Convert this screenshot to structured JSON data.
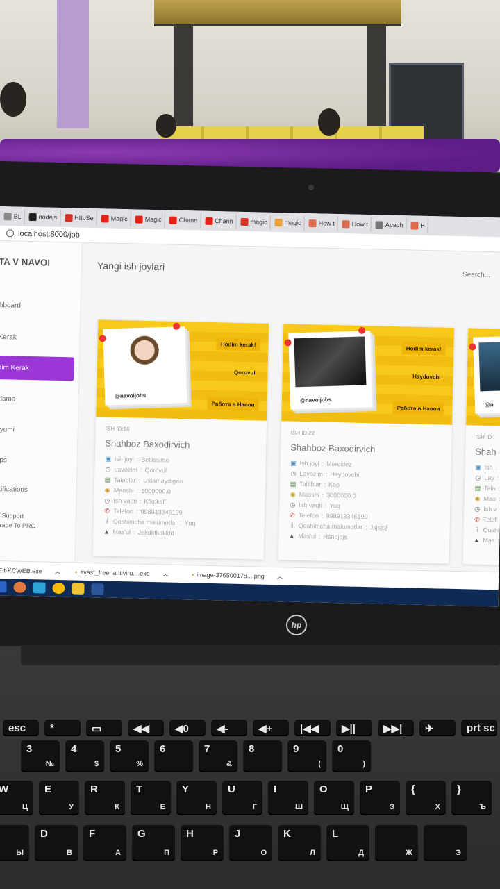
{
  "browser": {
    "tabs": [
      {
        "label": "BL",
        "color": "#888"
      },
      {
        "label": "nodejs",
        "color": "#222"
      },
      {
        "label": "HttpSe",
        "color": "#d93025"
      },
      {
        "label": "Magic",
        "color": "#e62117"
      },
      {
        "label": "Magic",
        "color": "#e62117"
      },
      {
        "label": "Chann",
        "color": "#e62117"
      },
      {
        "label": "Chann",
        "color": "#e62117"
      },
      {
        "label": "magic",
        "color": "#d93025"
      },
      {
        "label": "magic",
        "color": "#e8a33c"
      },
      {
        "label": "How t",
        "color": "#e06c50"
      },
      {
        "label": "How t",
        "color": "#e06c50"
      },
      {
        "label": "Apach",
        "color": "#777"
      },
      {
        "label": "H",
        "color": "#e06c50"
      }
    ],
    "url": "localhost:8000/job"
  },
  "app": {
    "brand": "TA V NAVOI",
    "nav": [
      "hboard",
      "Kerak",
      "dim Kerak",
      "klama",
      "zyumi",
      "aps",
      "otifications"
    ],
    "nav_active_index": 2,
    "support": [
      "TL Support",
      "pgrade To PRO"
    ],
    "page_title": "Yangi ish joylari",
    "search_placeholder": "Search..."
  },
  "jobs": [
    {
      "id": "ISH ID:16",
      "author": "Shahboz Baxodirvich",
      "banner": {
        "title": "Hodim kerak!",
        "role": "Qorovul",
        "footer": "Работа в Навои",
        "handle": "@navoijobs"
      },
      "fields": [
        {
          "label": "Ish joyi",
          "value": "Bellissimo",
          "icon": "image-icon"
        },
        {
          "label": "Lavozim",
          "value": "Qorovul",
          "icon": "clock-icon"
        },
        {
          "label": "Talablar",
          "value": "Uxlamaydigan",
          "icon": "list-icon"
        },
        {
          "label": "Maoshi",
          "value": "1000000.0",
          "icon": "money-icon"
        },
        {
          "label": "Ish vaqti",
          "value": "Kfkdkslf",
          "icon": "clock-icon"
        },
        {
          "label": "Telefon",
          "value": "998913346199",
          "icon": "phone-icon"
        },
        {
          "label": "Qoshimcha malumotlar",
          "value": "Yuq",
          "icon": "info-icon"
        },
        {
          "label": "Mas'ul",
          "value": "Jekdkfkdkldd",
          "icon": "user-icon"
        }
      ]
    },
    {
      "id": "ISH ID:22",
      "author": "Shahboz Baxodirvich",
      "banner": {
        "title": "Hodim kerak!",
        "role": "Haydovchi",
        "footer": "Работа в Навои",
        "handle": "@navoijobs"
      },
      "fields": [
        {
          "label": "Ish joyi",
          "value": "Mercidez",
          "icon": "image-icon"
        },
        {
          "label": "Lavozim",
          "value": "Haydovchi",
          "icon": "clock-icon"
        },
        {
          "label": "Talablar",
          "value": "Kop",
          "icon": "list-icon"
        },
        {
          "label": "Maoshi",
          "value": "3000000.0",
          "icon": "money-icon"
        },
        {
          "label": "Ish vaqti",
          "value": "Yuq",
          "icon": "clock-icon"
        },
        {
          "label": "Telefon",
          "value": "998913346199",
          "icon": "phone-icon"
        },
        {
          "label": "Qoshimcha malumotlar",
          "value": "Jsjsjdj",
          "icon": "info-icon"
        },
        {
          "label": "Mas'ul",
          "value": "Hsndjdjs",
          "icon": "user-icon"
        }
      ]
    },
    {
      "id": "ISH ID:",
      "author": "Shah",
      "banner": {
        "title": "",
        "role": "",
        "footer": "",
        "handle": "@n"
      },
      "fields": [
        {
          "label": "Ish",
          "value": "",
          "icon": "image-icon"
        },
        {
          "label": "Lav",
          "value": "",
          "icon": "clock-icon"
        },
        {
          "label": "Tala",
          "value": "",
          "icon": "list-icon"
        },
        {
          "label": "Mao",
          "value": "",
          "icon": "money-icon"
        },
        {
          "label": "Ish v",
          "value": "",
          "icon": "clock-icon"
        },
        {
          "label": "Telef",
          "value": "",
          "icon": "phone-icon"
        },
        {
          "label": "Qoshi",
          "value": "",
          "icon": "info-icon"
        },
        {
          "label": "Mas",
          "value": "",
          "icon": "user-icon"
        }
      ]
    }
  ],
  "downloads": [
    {
      "name": "Elt-KCWEB.exe"
    },
    {
      "name": "avast_free_antiviru....exe"
    },
    {
      "name": "image-376500178....png"
    }
  ],
  "laptop_brand": "hp",
  "keyboard": {
    "row1": [
      "esc",
      "*",
      "▭",
      "◀◀",
      "◀0",
      "◀-",
      "◀+",
      "|◀◀",
      "▶||",
      "▶▶|",
      "✈",
      "prt sc"
    ],
    "row2": [
      [
        "3",
        "№"
      ],
      [
        "4",
        "$"
      ],
      [
        "5",
        "%"
      ],
      [
        "6",
        ""
      ],
      [
        "7",
        "&"
      ],
      [
        "8",
        ""
      ],
      [
        "9",
        "("
      ],
      [
        "0",
        ")"
      ]
    ],
    "row3": [
      [
        "W",
        "Ц"
      ],
      [
        "E",
        "У"
      ],
      [
        "R",
        "К"
      ],
      [
        "T",
        "Е"
      ],
      [
        "Y",
        "Н"
      ],
      [
        "U",
        "Г"
      ],
      [
        "I",
        "Ш"
      ],
      [
        "O",
        "Щ"
      ],
      [
        "P",
        "З"
      ],
      [
        "{",
        "Х"
      ],
      [
        "}",
        "Ъ"
      ]
    ],
    "row4": [
      [
        "",
        "Ы"
      ],
      [
        "D",
        "В"
      ],
      [
        "F",
        "А"
      ],
      [
        "G",
        "П"
      ],
      [
        "H",
        "Р"
      ],
      [
        "J",
        "О"
      ],
      [
        "K",
        "Л"
      ],
      [
        "L",
        "Д"
      ],
      [
        "",
        "Ж"
      ],
      [
        "",
        "Э"
      ]
    ]
  },
  "colors": {
    "accent": "#9b37d6",
    "banner_yellow": "#f7c91a",
    "taskbar": "#102a56"
  }
}
